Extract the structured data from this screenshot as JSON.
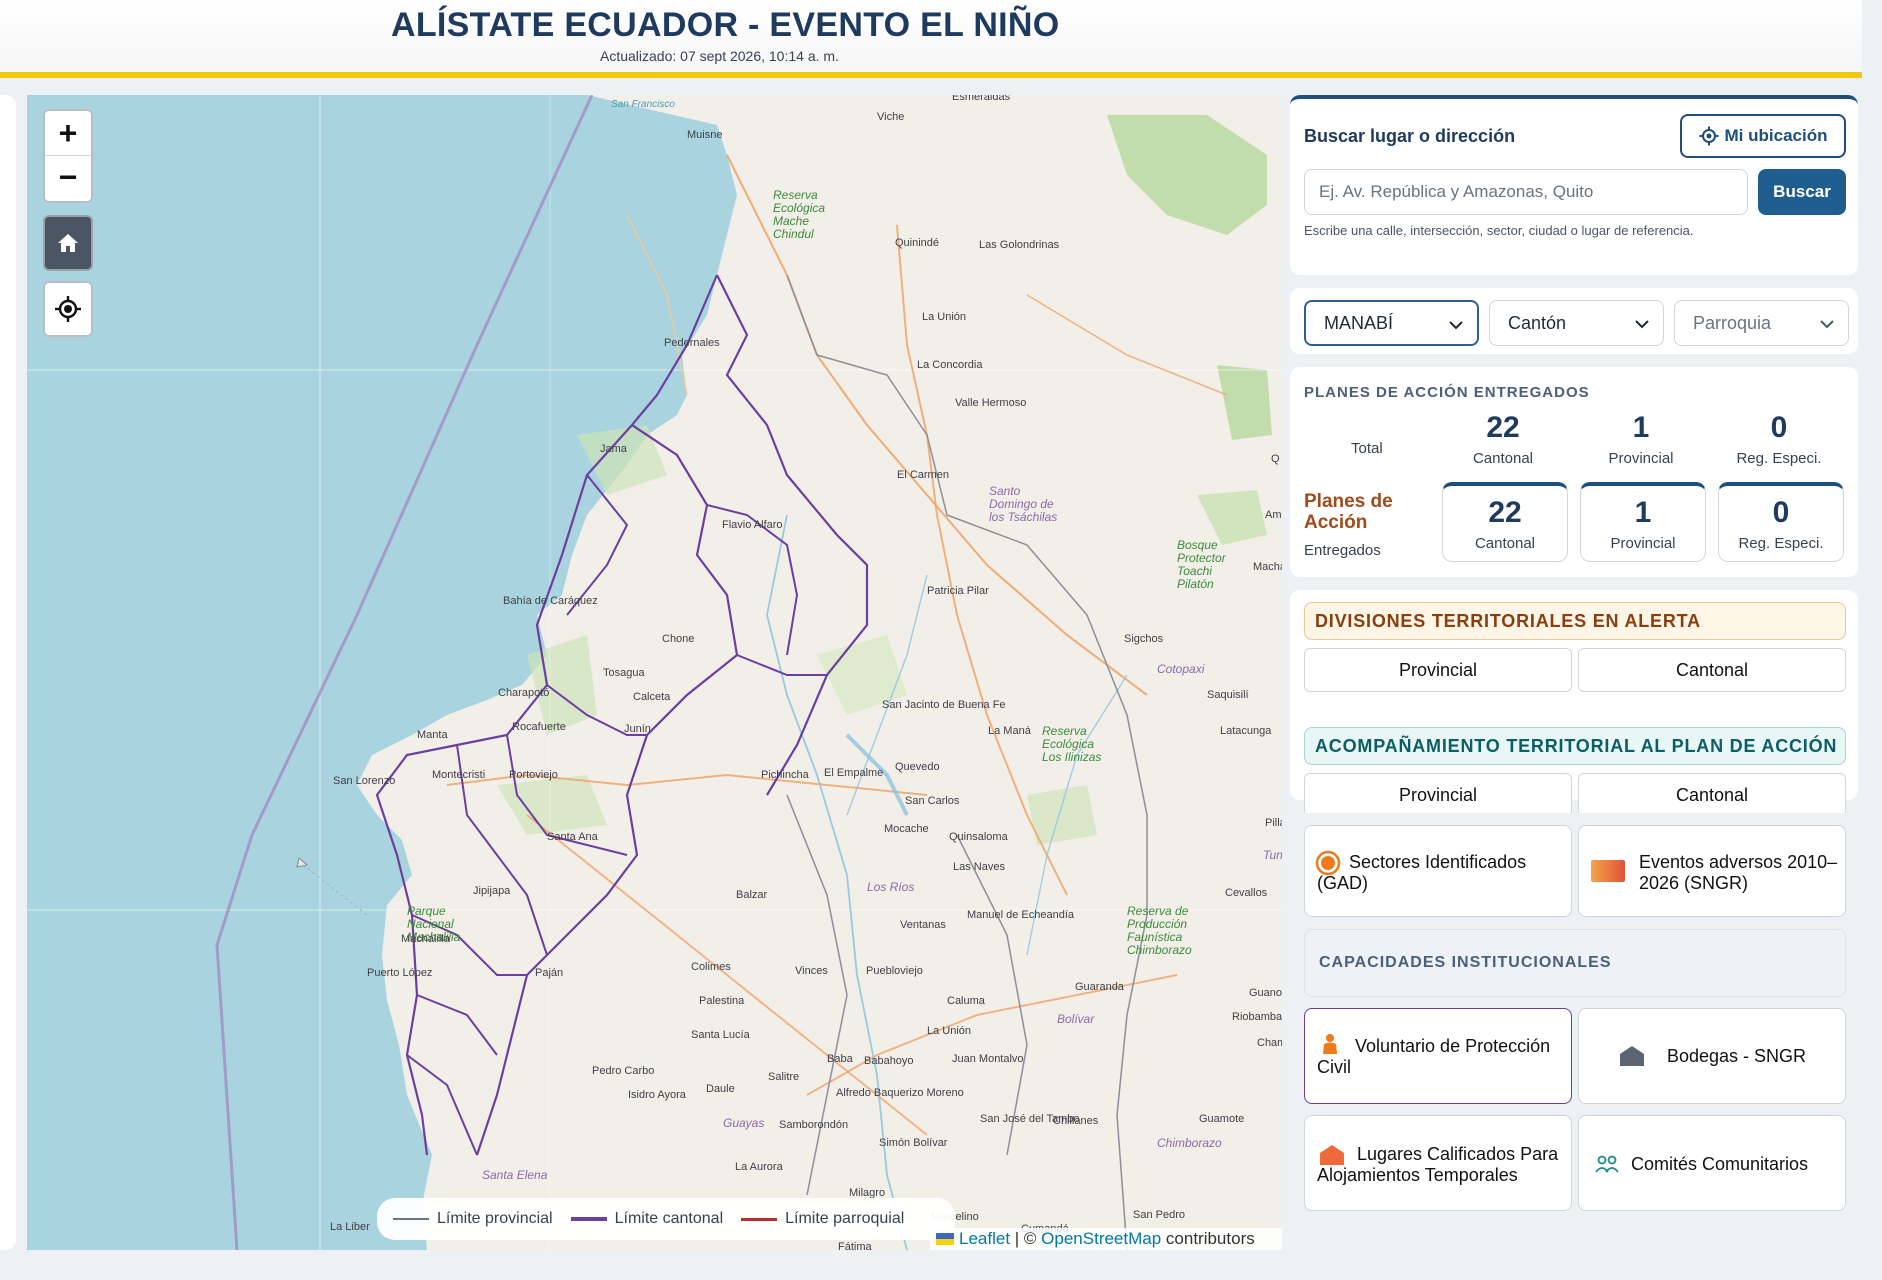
{
  "header": {
    "title": "ALÍSTATE ECUADOR - EVENTO EL NIÑO",
    "updated": "Actualizado: 07 sept 2026, 10:14 a. m."
  },
  "map": {
    "controls": {
      "zoom_in": "+",
      "zoom_out": "−"
    },
    "places": [
      {
        "id": "sanfrancisco",
        "name": "San Francisco",
        "style": "water"
      },
      {
        "id": "esmeraldas",
        "name": "Esmeraldas",
        "style": "normal"
      },
      {
        "id": "viche",
        "name": "Viche",
        "style": "normal"
      },
      {
        "id": "muisne",
        "name": "Muisne",
        "style": "normal"
      },
      {
        "id": "reserva1",
        "name": "Reserva Ecológica Mache Chindul",
        "style": "green"
      },
      {
        "id": "quininde",
        "name": "Quinindé",
        "style": "normal"
      },
      {
        "id": "golondrinas",
        "name": "Las Golondrinas",
        "style": "normal"
      },
      {
        "id": "launion1",
        "name": "La Unión",
        "style": "normal"
      },
      {
        "id": "pedernales",
        "name": "Pedernales",
        "style": "normal"
      },
      {
        "id": "laconcordia",
        "name": "La Concordia",
        "style": "normal"
      },
      {
        "id": "vallehermoso",
        "name": "Valle Hermoso",
        "style": "normal"
      },
      {
        "id": "jama",
        "name": "Jama",
        "style": "normal"
      },
      {
        "id": "elcarmen",
        "name": "El Carmen",
        "style": "normal"
      },
      {
        "id": "santodomingo",
        "name": "Santo Domingo de los Tsáchilas",
        "style": "purple"
      },
      {
        "id": "flavioalfaro",
        "name": "Flavio Alfaro",
        "style": "normal"
      },
      {
        "id": "bosque",
        "name": "Bosque Protector Toachi Pilatón",
        "style": "green"
      },
      {
        "id": "bahia",
        "name": "Bahía de Caráquez",
        "style": "normal"
      },
      {
        "id": "patricia",
        "name": "Patricia Pilar",
        "style": "normal"
      },
      {
        "id": "chone",
        "name": "Chone",
        "style": "normal"
      },
      {
        "id": "sigchos",
        "name": "Sigchos",
        "style": "normal"
      },
      {
        "id": "cotopaxi",
        "name": "Cotopaxi",
        "style": "purple"
      },
      {
        "id": "tosagua",
        "name": "Tosagua",
        "style": "normal"
      },
      {
        "id": "charapoto",
        "name": "Charapotó",
        "style": "normal"
      },
      {
        "id": "calceta",
        "name": "Calceta",
        "style": "normal"
      },
      {
        "id": "saquisili",
        "name": "Saquisilí",
        "style": "normal"
      },
      {
        "id": "rocafuerte",
        "name": "Rocafuerte",
        "style": "normal"
      },
      {
        "id": "junin",
        "name": "Junín",
        "style": "normal"
      },
      {
        "id": "sanjacinto",
        "name": "San Jacinto de Buena Fe",
        "style": "normal"
      },
      {
        "id": "lamana",
        "name": "La Maná",
        "style": "normal"
      },
      {
        "id": "reserva2",
        "name": "Reserva Ecológica Los Ilinizas",
        "style": "green"
      },
      {
        "id": "latacunga",
        "name": "Latacunga",
        "style": "normal"
      },
      {
        "id": "manta",
        "name": "Manta",
        "style": "normal"
      },
      {
        "id": "montecristi",
        "name": "Montecristi",
        "style": "normal"
      },
      {
        "id": "portoviejo",
        "name": "Portoviejo",
        "style": "normal"
      },
      {
        "id": "pichincha",
        "name": "Pichincha",
        "style": "normal"
      },
      {
        "id": "elempalme",
        "name": "El Empalme",
        "style": "normal"
      },
      {
        "id": "quevedo",
        "name": "Quevedo",
        "style": "normal"
      },
      {
        "id": "sanlorenzo",
        "name": "San Lorenzo",
        "style": "normal"
      },
      {
        "id": "sancarlos",
        "name": "San Carlos",
        "style": "normal"
      },
      {
        "id": "mocache",
        "name": "Mocache",
        "style": "normal"
      },
      {
        "id": "quinsaloma",
        "name": "Quinsaloma",
        "style": "normal"
      },
      {
        "id": "santaana",
        "name": "Santa Ana",
        "style": "normal"
      },
      {
        "id": "lasnaves",
        "name": "Las Naves",
        "style": "normal"
      },
      {
        "id": "jipijapa",
        "name": "Jipijapa",
        "style": "normal"
      },
      {
        "id": "losrios",
        "name": "Los Ríos",
        "style": "purple"
      },
      {
        "id": "balzar",
        "name": "Balzar",
        "style": "normal"
      },
      {
        "id": "cevallos",
        "name": "Cevallos",
        "style": "normal"
      },
      {
        "id": "parquemach",
        "name": "Parque Nacional Machalilla",
        "style": "green"
      },
      {
        "id": "ventanas",
        "name": "Ventanas",
        "style": "normal"
      },
      {
        "id": "echeandia",
        "name": "Manuel de Echeandía",
        "style": "normal"
      },
      {
        "id": "reserva3",
        "name": "Reserva de Producción Faunística Chimborazo",
        "style": "green"
      },
      {
        "id": "machalilla",
        "name": "Machalilla",
        "style": "normal"
      },
      {
        "id": "colimes",
        "name": "Colimes",
        "style": "normal"
      },
      {
        "id": "vinces",
        "name": "Vinces",
        "style": "normal"
      },
      {
        "id": "pueblo",
        "name": "Puebloviejo",
        "style": "normal"
      },
      {
        "id": "puertolopez",
        "name": "Puerto López",
        "style": "normal"
      },
      {
        "id": "pajan",
        "name": "Paján",
        "style": "normal"
      },
      {
        "id": "guaranda",
        "name": "Guaranda",
        "style": "normal"
      },
      {
        "id": "guano",
        "name": "Guano",
        "style": "normal"
      },
      {
        "id": "palestina",
        "name": "Palestina",
        "style": "normal"
      },
      {
        "id": "caluma",
        "name": "Caluma",
        "style": "normal"
      },
      {
        "id": "bolivar",
        "name": "Bolívar",
        "style": "purple"
      },
      {
        "id": "riobamba",
        "name": "Riobamba",
        "style": "normal"
      },
      {
        "id": "santalucia",
        "name": "Santa Lucía",
        "style": "normal"
      },
      {
        "id": "launion2",
        "name": "La Unión",
        "style": "normal"
      },
      {
        "id": "chambo",
        "name": "Chambo",
        "style": "normal"
      },
      {
        "id": "baba",
        "name": "Baba",
        "style": "normal"
      },
      {
        "id": "babahoyo",
        "name": "Babahoyo",
        "style": "normal"
      },
      {
        "id": "juanmontalvo",
        "name": "Juan Montalvo",
        "style": "normal"
      },
      {
        "id": "pedrocarbo",
        "name": "Pedro Carbo",
        "style": "normal"
      },
      {
        "id": "salitre",
        "name": "Salitre",
        "style": "normal"
      },
      {
        "id": "isidro",
        "name": "Isidro Ayora",
        "style": "normal"
      },
      {
        "id": "daule",
        "name": "Daule",
        "style": "normal"
      },
      {
        "id": "alfredo",
        "name": "Alfredo Baquerizo Moreno",
        "style": "normal"
      },
      {
        "id": "sanjose",
        "name": "San José del Tambo",
        "style": "normal"
      },
      {
        "id": "chillanes",
        "name": "Chillanes",
        "style": "normal"
      },
      {
        "id": "guamote",
        "name": "Guamote",
        "style": "normal"
      },
      {
        "id": "guayas",
        "name": "Guayas",
        "style": "purple"
      },
      {
        "id": "samborondon",
        "name": "Samborondón",
        "style": "normal"
      },
      {
        "id": "simonbolivar",
        "name": "Simón Bolívar",
        "style": "normal"
      },
      {
        "id": "chimborazo",
        "name": "Chimborazo",
        "style": "purple"
      },
      {
        "id": "santaelena",
        "name": "Santa Elena",
        "style": "purple"
      },
      {
        "id": "laaurora",
        "name": "La Aurora",
        "style": "normal"
      },
      {
        "id": "milagro",
        "name": "Milagro",
        "style": "normal"
      },
      {
        "id": "laliber",
        "name": "La Liber",
        "style": "normal"
      },
      {
        "id": "marcelino",
        "name": "Marcelino",
        "style": "normal"
      },
      {
        "id": "cumanda",
        "name": "Cumandá",
        "style": "normal"
      },
      {
        "id": "sanpedro",
        "name": "San Pedro",
        "style": "normal"
      },
      {
        "id": "fatima",
        "name": "Fátima",
        "style": "normal"
      },
      {
        "id": "edge1",
        "name": "Q",
        "style": "normal"
      },
      {
        "id": "edge2",
        "name": "Am",
        "style": "normal"
      },
      {
        "id": "edge3",
        "name": "Machac",
        "style": "normal"
      },
      {
        "id": "edge4",
        "name": "Pilla",
        "style": "normal"
      },
      {
        "id": "edge5",
        "name": "Tun",
        "style": "purple"
      }
    ],
    "legend": [
      {
        "label": "Límite provincial",
        "color": "#6b7280"
      },
      {
        "label": "Límite cantonal",
        "color": "#6b3fa0"
      },
      {
        "label": "Límite parroquial",
        "color": "#b03030"
      }
    ],
    "attribution": {
      "leaflet": "Leaflet",
      "sep": " | © ",
      "osm": "OpenStreetMap",
      "suffix": " contributors"
    }
  },
  "search": {
    "label": "Buscar lugar o dirección",
    "my_location": "Mi ubicación",
    "placeholder": "Ej. Av. República y Amazonas, Quito",
    "button": "Buscar",
    "help": "Escribe una calle, intersección, sector, ciudad o lugar de referencia."
  },
  "selects": {
    "province": "MANABÍ",
    "canton": "Cantón",
    "parish": "Parroquia"
  },
  "plans": {
    "title": "PLANES DE ACCIÓN ENTREGADOS",
    "total_label": "Total",
    "totals": [
      {
        "value": "22",
        "label": "Cantonal"
      },
      {
        "value": "1",
        "label": "Provincial"
      },
      {
        "value": "0",
        "label": "Reg. Especi."
      }
    ],
    "side_title": "Planes de Acción",
    "side_sub": "Entregados",
    "delivered": [
      {
        "value": "22",
        "label": "Cantonal"
      },
      {
        "value": "1",
        "label": "Provincial"
      },
      {
        "value": "0",
        "label": "Reg. Especi."
      }
    ]
  },
  "alert": {
    "title": "DIVISIONES TERRITORIALES EN ALERTA",
    "provincial": "Provincial",
    "cantonal": "Cantonal"
  },
  "accompaniment": {
    "title": "ACOMPAÑAMIENTO TERRITORIAL AL PLAN DE ACCIÓN",
    "provincial": "Provincial",
    "cantonal": "Cantonal"
  },
  "layers": {
    "sectors": "Sectores Identificados (GAD)",
    "events": "Eventos adversos 2010–2026 (SNGR)",
    "capabilities_title": "CAPACIDADES INSTITUCIONALES",
    "volunteer": "Voluntario de Protección Civil",
    "warehouses": "Bodegas - SNGR",
    "shelters": "Lugares Calificados Para Alojamientos Temporales",
    "committees": "Comités Comunitarios"
  },
  "colors": {
    "brand_navy": "#1e3a5f",
    "accent_yellow": "#f2c80f",
    "button_blue": "#1e5d8e",
    "alert_brown": "#8a3d0f",
    "teal": "#0b5e63",
    "cantonal_line": "#6b3fa0"
  },
  "icons": [
    "plus-icon",
    "minus-icon",
    "home-icon",
    "locate-icon",
    "crosshair-icon",
    "chevron-down-icon",
    "orange-circle-icon",
    "gradient-swatch-icon",
    "person-icon",
    "warehouse-icon",
    "house-icon",
    "people-icon"
  ]
}
